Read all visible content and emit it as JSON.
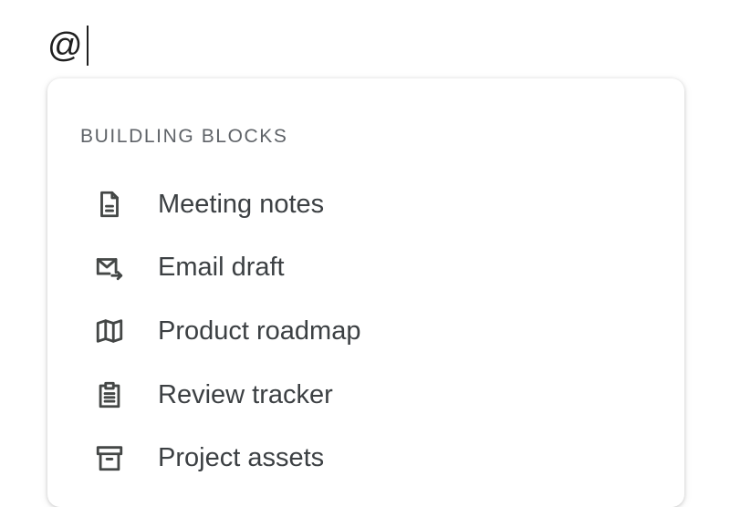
{
  "editor": {
    "typed_text": "@"
  },
  "menu": {
    "section_header": "BUILDLING BLOCKS",
    "items": [
      {
        "label": "Meeting notes",
        "icon": "document-icon"
      },
      {
        "label": "Email draft",
        "icon": "email-send-icon"
      },
      {
        "label": "Product roadmap",
        "icon": "map-icon"
      },
      {
        "label": "Review tracker",
        "icon": "clipboard-icon"
      },
      {
        "label": "Project assets",
        "icon": "archive-icon"
      }
    ]
  },
  "colors": {
    "text_primary": "#3c4043",
    "text_secondary": "#5f6368",
    "icon": "#444746"
  }
}
